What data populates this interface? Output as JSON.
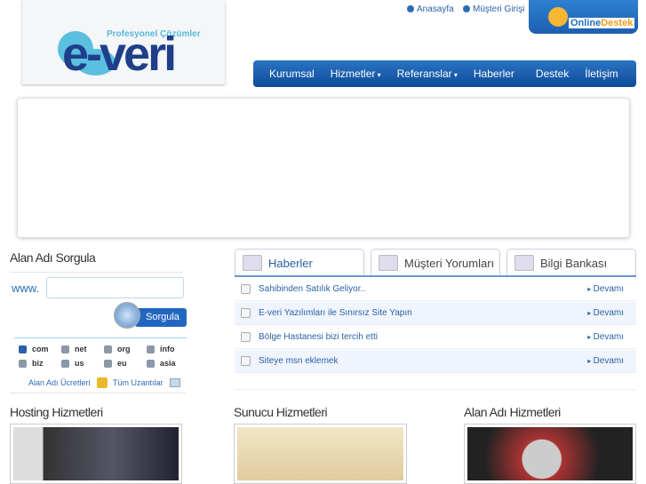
{
  "logo": {
    "tagline": "Profesyonel Çözümler",
    "brand": "e-veri"
  },
  "toplinks": [
    "Anasayfa",
    "Müşteri Girişi"
  ],
  "online": {
    "a": "Online",
    "b": "Destek"
  },
  "nav": [
    "Kurumsal",
    "Hizmetler",
    "Referanslar",
    "Haberler",
    "Destek",
    "İletişim"
  ],
  "domain": {
    "title": "Alan Adı Sorgula",
    "prefix": "www.",
    "input_value": "",
    "button": "Sorgula",
    "tlds": [
      {
        "label": "com",
        "checked": true
      },
      {
        "label": "net",
        "checked": false
      },
      {
        "label": "org",
        "checked": false
      },
      {
        "label": "info",
        "checked": false
      },
      {
        "label": "biz",
        "checked": false
      },
      {
        "label": "us",
        "checked": false
      },
      {
        "label": "eu",
        "checked": false
      },
      {
        "label": "asia",
        "checked": false
      }
    ],
    "link_prices": "Alan Adı Ücretleri",
    "link_all": "Tüm Uzantılar"
  },
  "tabs": [
    "Haberler",
    "Müşteri Yorumları",
    "Bilgi Bankası"
  ],
  "news": [
    {
      "title": "Sahibinden Satılık Geliyor..",
      "more": "Devamı"
    },
    {
      "title": "E-veri Yazılımları ile Sınırsız Site Yapın",
      "more": "Devamı"
    },
    {
      "title": "Bölge Hastanesi bizi tercih etti",
      "more": "Devamı"
    },
    {
      "title": "Siteye msn eklemek",
      "more": "Devamı"
    }
  ],
  "services": [
    "Hosting Hizmetleri",
    "Sunucu Hizmetleri",
    "Alan Adı Hizmetleri"
  ]
}
